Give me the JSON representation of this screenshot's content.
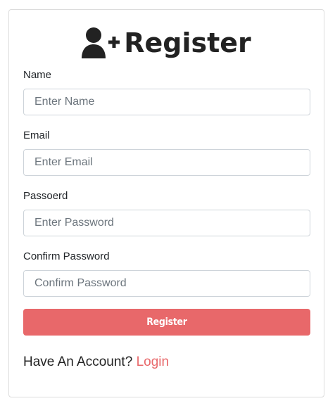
{
  "header": {
    "icon": "user-plus-icon",
    "title": "Register"
  },
  "form": {
    "name": {
      "label": "Name",
      "placeholder": "Enter Name",
      "value": ""
    },
    "email": {
      "label": "Email",
      "placeholder": "Enter Email",
      "value": ""
    },
    "password": {
      "label": "Passoerd",
      "placeholder": "Enter Password",
      "value": ""
    },
    "confirm": {
      "label": "Confirm Password",
      "placeholder": "Confirm Password",
      "value": ""
    },
    "submit_label": "Register"
  },
  "footer": {
    "prompt": "Have An Account?",
    "link_label": "Login"
  },
  "colors": {
    "accent": "#e8686a",
    "heading": "#222222",
    "border": "#ced4da"
  }
}
